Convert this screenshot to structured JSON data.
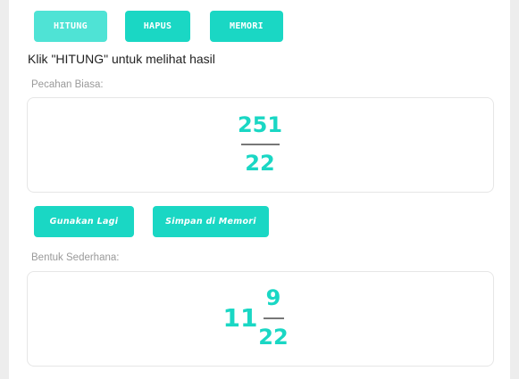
{
  "toolbar": {
    "hitung_label": "HITUNG",
    "hapus_label": "HAPUS",
    "memori_label": "MEMORI"
  },
  "hint": "Klik \"HITUNG\" untuk melihat hasil",
  "fraction": {
    "label": "Pecahan Biasa:",
    "numerator": "251",
    "denominator": "22"
  },
  "actions": {
    "use_again_label": "Gunakan Lagi",
    "save_memory_label": "Simpan di Memori"
  },
  "simplified": {
    "label": "Bentuk Sederhana:",
    "whole": "11",
    "numerator": "9",
    "denominator": "22"
  },
  "colors": {
    "accent": "#1ad7c4",
    "accent_active": "#4fe3d5",
    "background": "#ededed"
  }
}
